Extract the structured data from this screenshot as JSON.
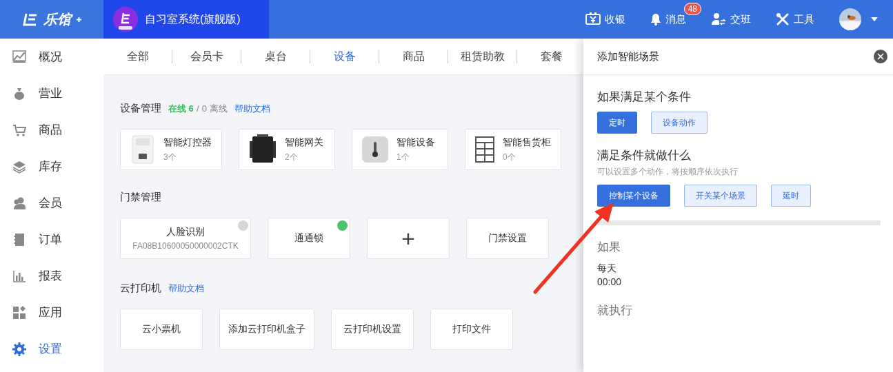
{
  "header": {
    "logo_text": "乐馆",
    "brand_title": "自习室系统(旗舰版)",
    "actions": [
      {
        "label": "收银"
      },
      {
        "label": "消息",
        "badge": "48"
      },
      {
        "label": "交班"
      },
      {
        "label": "工具"
      }
    ]
  },
  "sidebar": {
    "items": [
      {
        "label": "概况",
        "selected": false
      },
      {
        "label": "营业",
        "selected": false
      },
      {
        "label": "商品",
        "selected": false
      },
      {
        "label": "库存",
        "selected": false
      },
      {
        "label": "会员",
        "selected": false
      },
      {
        "label": "订单",
        "selected": false
      },
      {
        "label": "报表",
        "selected": false
      },
      {
        "label": "应用",
        "selected": false
      },
      {
        "label": "设置",
        "selected": true
      }
    ]
  },
  "tabs": [
    {
      "label": "全部",
      "selected": false
    },
    {
      "label": "会员卡",
      "selected": false
    },
    {
      "label": "桌台",
      "selected": false
    },
    {
      "label": "设备",
      "selected": true
    },
    {
      "label": "商品",
      "selected": false
    },
    {
      "label": "租赁助教",
      "selected": false
    },
    {
      "label": "套餐",
      "selected": false
    }
  ],
  "device_section": {
    "title": "设备管理",
    "online": "在线 6",
    "separator": "/",
    "offline": "0 离线",
    "help_link": "帮助文档",
    "devices": [
      {
        "kind": "light",
        "name": "智能灯控器",
        "count": "3个"
      },
      {
        "kind": "gateway",
        "name": "智能网关",
        "count": "2个"
      },
      {
        "kind": "sensor",
        "name": "智能设备",
        "count": "1个"
      },
      {
        "kind": "cabinet",
        "name": "智能售货柜",
        "count": "0个"
      }
    ]
  },
  "door_section": {
    "title": "门禁管理",
    "items": [
      {
        "kind": "device",
        "name": "人脸识别",
        "subtitle": "FA08B10600050000002CTK",
        "online": false
      },
      {
        "kind": "device",
        "name": "通通锁",
        "online": true
      },
      {
        "kind": "add",
        "label": "+"
      },
      {
        "kind": "action",
        "name": "门禁设置"
      }
    ]
  },
  "printer_section": {
    "title": "云打印机",
    "help_link": "帮助文档",
    "buttons": [
      "云小票机",
      "添加云打印机盒子",
      "云打印机设置",
      "打印文件"
    ]
  },
  "drawer": {
    "title": "添加智能场景",
    "condition_heading": "如果满足某个条件",
    "conditions": [
      {
        "label": "定时",
        "selected": true
      },
      {
        "label": "设备动作",
        "selected": false
      }
    ],
    "action_heading": "满足条件就做什么",
    "action_hint": "可以设置多个动作，将按顺序依次执行",
    "actions": [
      {
        "label": "控制某个设备",
        "selected": true
      },
      {
        "label": "开关某个场景",
        "selected": false
      },
      {
        "label": "延时",
        "selected": false
      }
    ],
    "summary_if": "如果",
    "summary_lines": [
      "每天",
      "00:00"
    ],
    "summary_then": "就执行"
  }
}
